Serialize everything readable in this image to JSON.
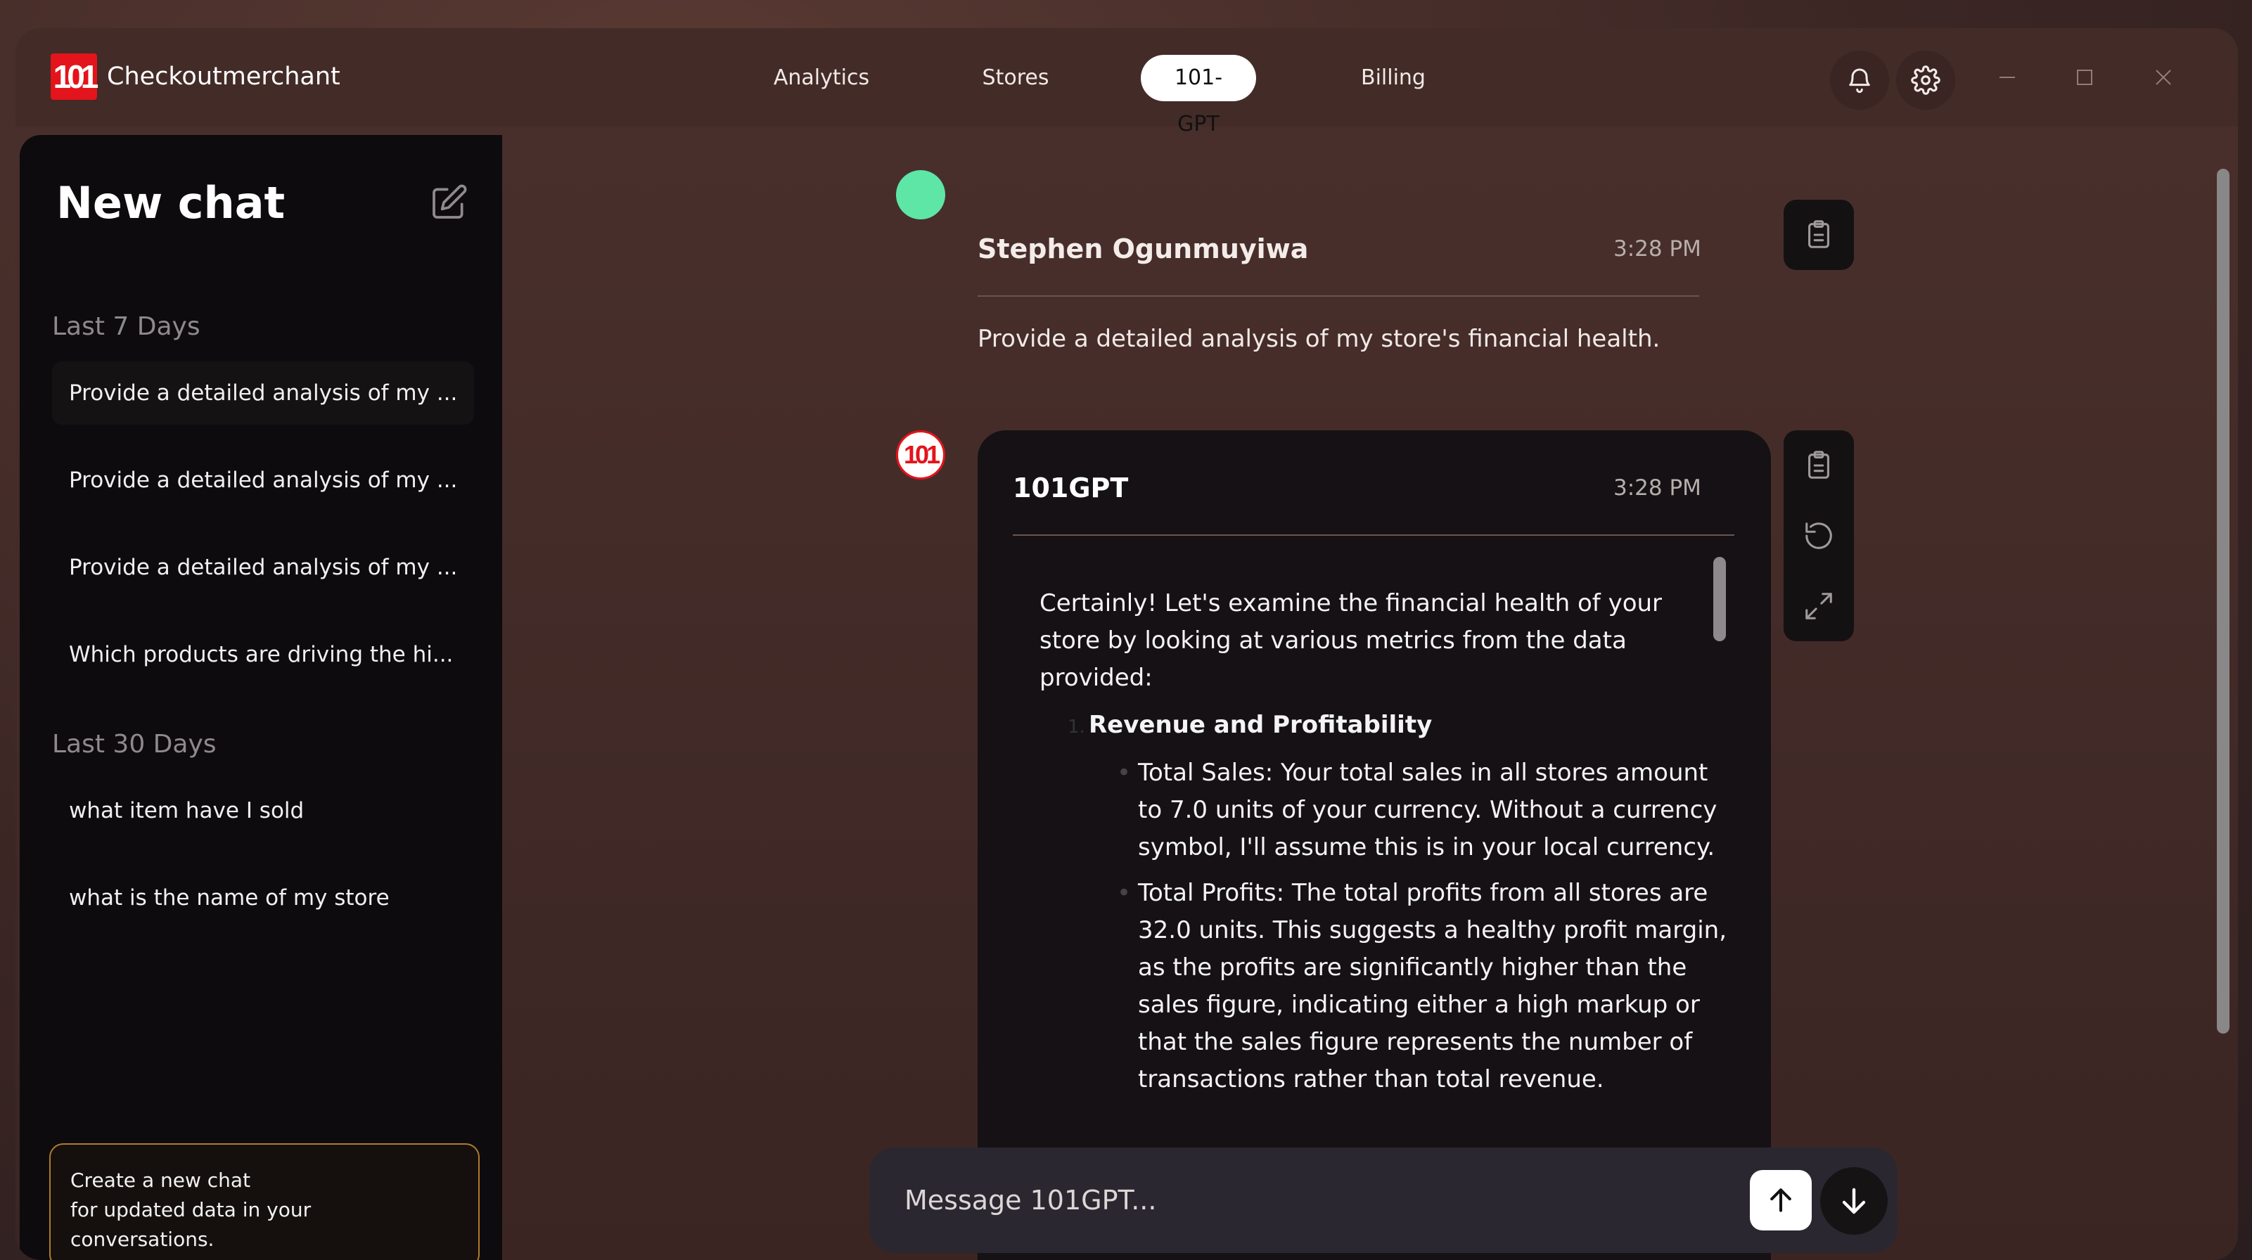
{
  "app": {
    "logo_mark": "101",
    "name": "Checkoutmerchant"
  },
  "nav": {
    "items": [
      "Analytics",
      "Stores",
      "101-GPT",
      "Billing"
    ],
    "active": "101-GPT"
  },
  "sidebar": {
    "title": "New chat",
    "sections": [
      {
        "label": "Last 7 Days",
        "items": [
          "Provide a detailed analysis of my ...",
          "Provide a detailed analysis of my ...",
          "Provide a detailed analysis of my ...",
          "Which products are driving the hi..."
        ]
      },
      {
        "label": "Last 30 Days",
        "items": [
          "what item have I sold",
          "what is the  name of my store"
        ]
      }
    ],
    "notice_lines": [
      "Create a new chat",
      "for updated data in your",
      "conversations."
    ]
  },
  "chat": {
    "user_message": {
      "author": "Stephen Ogunmuyiwa",
      "time": "3:28 PM",
      "text": "Provide a detailed analysis of my store's financial health."
    },
    "bot_message": {
      "author": "101GPT",
      "time": "3:28 PM",
      "intro": "Certainly! Let's examine the financial health of your store by looking at various metrics from the data provided:",
      "heading_num": "1.",
      "heading": "Revenue and Profitability",
      "bullets": [
        "Total Sales: Your total sales in all stores amount to 7.0 units of your currency. Without a currency symbol, I'll assume this is in your local currency.",
        "Total Profits: The total profits from all stores are 32.0 units. This suggests a healthy profit margin, as the profits are significantly higher than the sales figure, indicating either a high markup or that the sales figure represents the number of transactions rather than total revenue."
      ]
    }
  },
  "composer": {
    "placeholder": "Message 101GPT..."
  },
  "colors": {
    "brand_red": "#e3141b",
    "user_avatar": "#5ee6a7",
    "notice_border": "#b07a2c"
  }
}
